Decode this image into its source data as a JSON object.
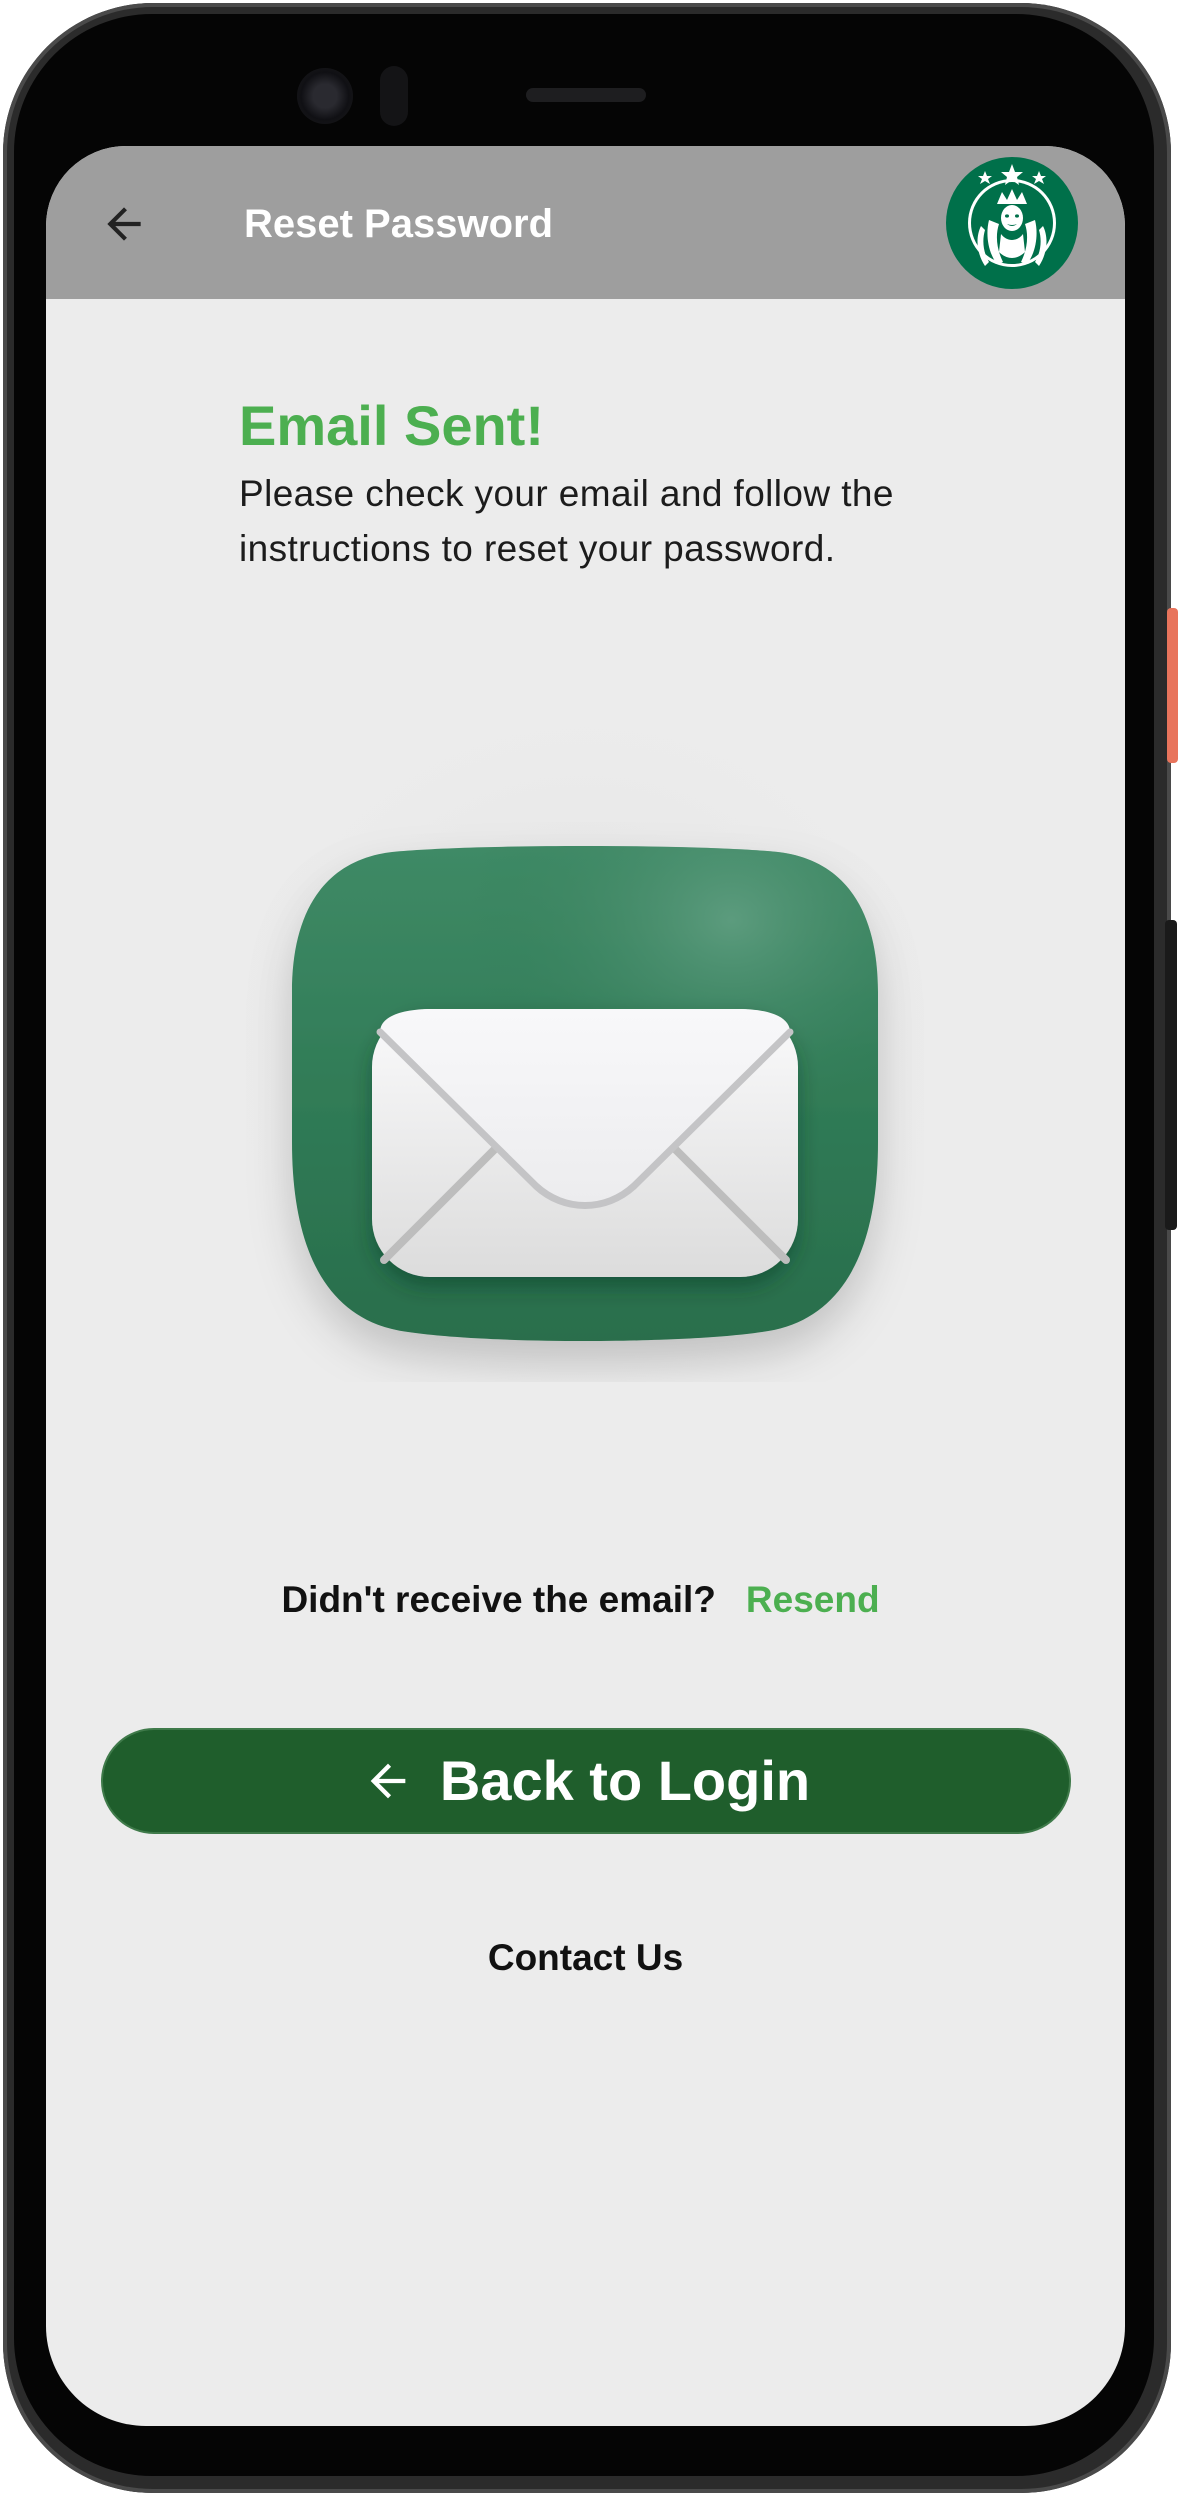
{
  "appbar": {
    "title": "Reset Password",
    "back_icon": "arrow-left-icon",
    "logo": "starbucks-siren-logo",
    "background": "#9e9e9e"
  },
  "content": {
    "heading": "Email Sent!",
    "description": "Please check your email and follow the instructions to reset your password.",
    "illustration_icon": "envelope-icon",
    "resend_question": "Didn't receive the email?",
    "resend_link": "Resend",
    "back_to_login_label": "Back to Login",
    "back_to_login_icon": "arrow-left-icon",
    "contact_us": "Contact Us"
  },
  "colors": {
    "accent_green": "#4caf50",
    "button_green": "#1f5e2c",
    "icon_green": "#2f7a55",
    "screen_background": "#ececec"
  }
}
